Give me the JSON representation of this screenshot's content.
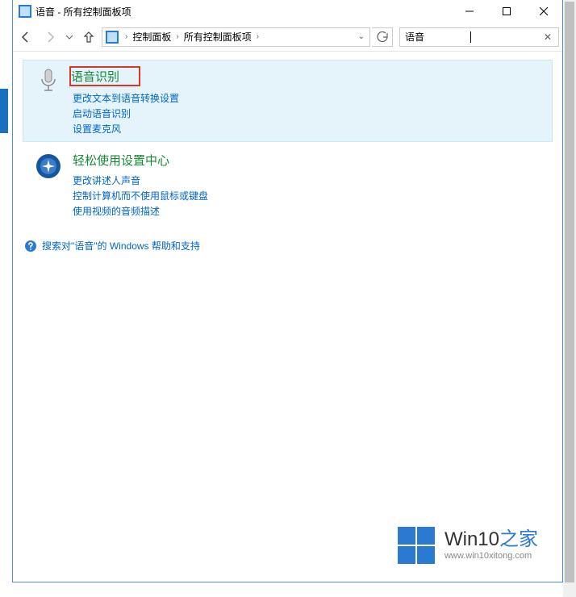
{
  "titlebar": {
    "title": "语音 - 所有控制面板项"
  },
  "breadcrumb": {
    "item1": "控制面板",
    "item2": "所有控制面板项"
  },
  "search": {
    "value": "语音"
  },
  "categories": [
    {
      "title": "语音识别",
      "links": [
        "更改文本到语音转换设置",
        "启动语音识别",
        "设置麦克风"
      ]
    },
    {
      "title": "轻松使用设置中心",
      "links": [
        "更改讲述人声音",
        "控制计算机而不使用鼠标或键盘",
        "使用视频的音频描述"
      ]
    }
  ],
  "help": {
    "text": "搜索对\"语音\"的 Windows 帮助和支持"
  },
  "watermark": {
    "main_a": "Win10",
    "main_b": "之家",
    "sub": "www.win10xitong.com"
  }
}
